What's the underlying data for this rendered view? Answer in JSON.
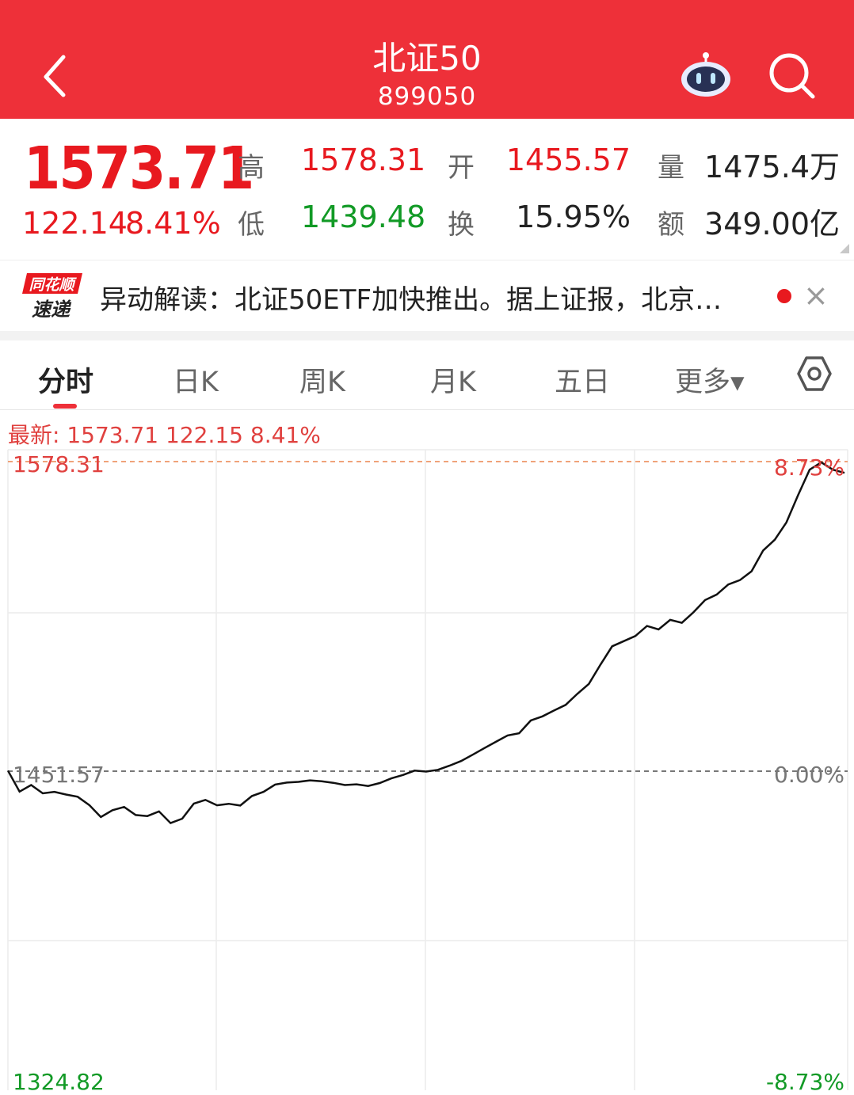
{
  "header": {
    "title": "北证50",
    "code": "899050",
    "back_icon": "chevron-left-icon",
    "robot_icon": "robot-assistant-icon",
    "search_icon": "search-icon",
    "background_color": "#ee3039"
  },
  "quote": {
    "price": "1573.71",
    "change": "122.14",
    "change_pct": "8.41%",
    "high_label": "高",
    "high": "1578.31",
    "low_label": "低",
    "low": "1439.48",
    "open_label": "开",
    "open": "1455.57",
    "turnover_label": "换",
    "turnover": "15.95%",
    "volume_label": "量",
    "volume": "1475.4万",
    "amount_label": "额",
    "amount": "349.00亿"
  },
  "news": {
    "logo_top": "同花顺",
    "logo_bottom": "速递",
    "text": "异动解读：北证50ETF加快推出。据上证报，北京…",
    "close": "×"
  },
  "tabs": [
    "分时",
    "日K",
    "周K",
    "月K",
    "五日",
    "更多▾"
  ],
  "active_tab": "分时",
  "latest_line": "最新: 1573.71  122.15  8.41%",
  "chart_data": {
    "type": "line",
    "y_top_label": "1578.31",
    "y_mid_label": "1451.57",
    "y_bottom_label": "1324.82",
    "pct_top_label": "8.73%",
    "pct_mid_label": "0.00%",
    "pct_bottom_label": "-8.73%",
    "ylim": [
      1324.82,
      1578.31
    ],
    "reference": 1451.57,
    "series": [
      {
        "values": [
          1451.8,
          1443.2,
          1445.9,
          1442.5,
          1443.1,
          1442.0,
          1441.1,
          1437.7,
          1432.8,
          1435.6,
          1436.9,
          1433.6,
          1433.2,
          1435.1,
          1430.3,
          1432.1,
          1438.3,
          1439.8,
          1437.6,
          1438.2,
          1437.5,
          1441.4,
          1443.1,
          1446.1,
          1446.9,
          1447.2,
          1447.8,
          1447.4,
          1446.8,
          1445.9,
          1446.2,
          1445.5,
          1446.7,
          1448.6,
          1450.0,
          1451.8,
          1451.4,
          1452.1,
          1453.8,
          1455.7,
          1458.3,
          1461.0,
          1463.6,
          1466.2,
          1467.1,
          1472.3,
          1474.0,
          1476.4,
          1478.7,
          1483.2,
          1487.3,
          1495.2,
          1502.7,
          1504.8,
          1506.9,
          1511.0,
          1509.6,
          1513.5,
          1512.3,
          1516.6,
          1521.6,
          1523.9,
          1528.0,
          1529.8,
          1533.4,
          1541.9,
          1546.3,
          1553.4,
          1564.5,
          1575.0,
          1578.0,
          1575.0,
          1573.7
        ]
      }
    ],
    "line_color": "#111111",
    "grid": true
  }
}
